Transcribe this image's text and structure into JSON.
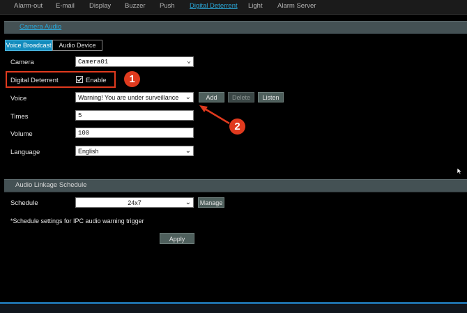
{
  "topnav": {
    "items": [
      {
        "label": "Alarm-out"
      },
      {
        "label": "E-mail"
      },
      {
        "label": "Display"
      },
      {
        "label": "Buzzer"
      },
      {
        "label": "Push"
      },
      {
        "label": "Digital Deterrent"
      },
      {
        "label": "Light"
      },
      {
        "label": "Alarm Server"
      }
    ],
    "active": "Digital Deterrent"
  },
  "section_camera_audio": {
    "title": "Camera Audio"
  },
  "subtabs": [
    {
      "label": "Voice Broadcast",
      "active": true
    },
    {
      "label": "Audio Device",
      "active": false
    }
  ],
  "form": {
    "camera": {
      "label": "Camera",
      "value": "Camera01"
    },
    "digital_deterrent": {
      "label": "Digital Deterrent",
      "checkbox_label": "Enable",
      "checked": true
    },
    "voice": {
      "label": "Voice",
      "value": "Warning! You are under surveillance"
    },
    "voice_buttons": {
      "add": "Add",
      "delete": "Delete",
      "listen": "Listen"
    },
    "times": {
      "label": "Times",
      "value": "5"
    },
    "volume": {
      "label": "Volume",
      "value": "100"
    },
    "language": {
      "label": "Language",
      "value": "English"
    }
  },
  "section_schedule": {
    "title": "Audio Linkage Schedule"
  },
  "schedule": {
    "label": "Schedule",
    "value": "24x7",
    "manage_label": "Manage",
    "note": "*Schedule settings for IPC audio warning trigger"
  },
  "apply_label": "Apply",
  "annotations": {
    "badge_1": "1",
    "badge_2": "2",
    "color": "#e03a1e"
  },
  "colors": {
    "accent": "#138cbd",
    "link": "#2aa6d6",
    "section_bar": "#445154",
    "button": "#4e5f5c"
  }
}
